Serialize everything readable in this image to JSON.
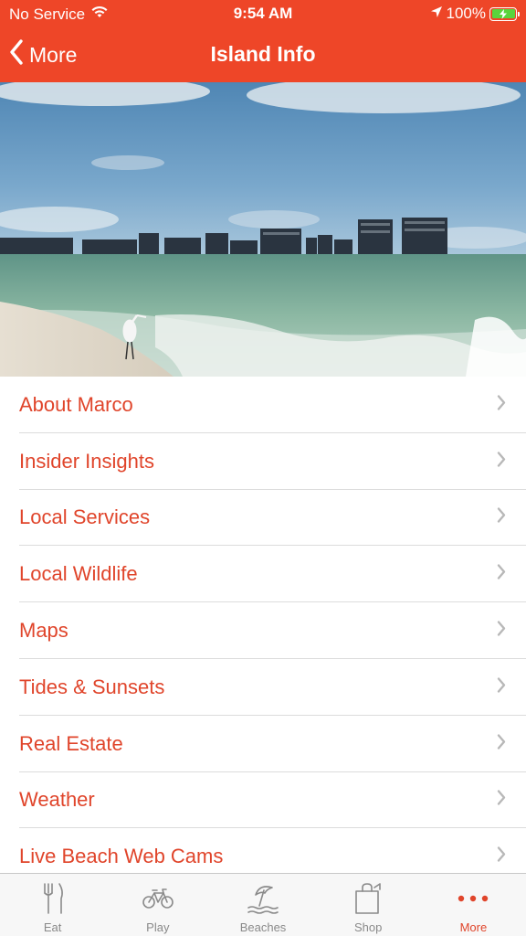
{
  "status_bar": {
    "carrier": "No Service",
    "time": "9:54 AM",
    "battery": "100%"
  },
  "nav": {
    "back_label": "More",
    "title": "Island Info"
  },
  "menu": {
    "items": [
      {
        "label": "About Marco"
      },
      {
        "label": "Insider Insights"
      },
      {
        "label": "Local Services"
      },
      {
        "label": "Local Wildlife"
      },
      {
        "label": "Maps"
      },
      {
        "label": "Tides & Sunsets"
      },
      {
        "label": "Real Estate"
      },
      {
        "label": "Weather"
      },
      {
        "label": "Live Beach Web Cams"
      }
    ]
  },
  "tabbar": {
    "tabs": [
      {
        "label": "Eat",
        "icon": "fork-knife-icon"
      },
      {
        "label": "Play",
        "icon": "bicycle-icon"
      },
      {
        "label": "Beaches",
        "icon": "beach-umbrella-icon"
      },
      {
        "label": "Shop",
        "icon": "shopping-bag-icon"
      },
      {
        "label": "More",
        "icon": "more-dots-icon",
        "active": true
      }
    ]
  },
  "colors": {
    "brand": "#ee4628",
    "accent_text": "#e0452b",
    "tab_inactive": "#8a8a8a"
  }
}
